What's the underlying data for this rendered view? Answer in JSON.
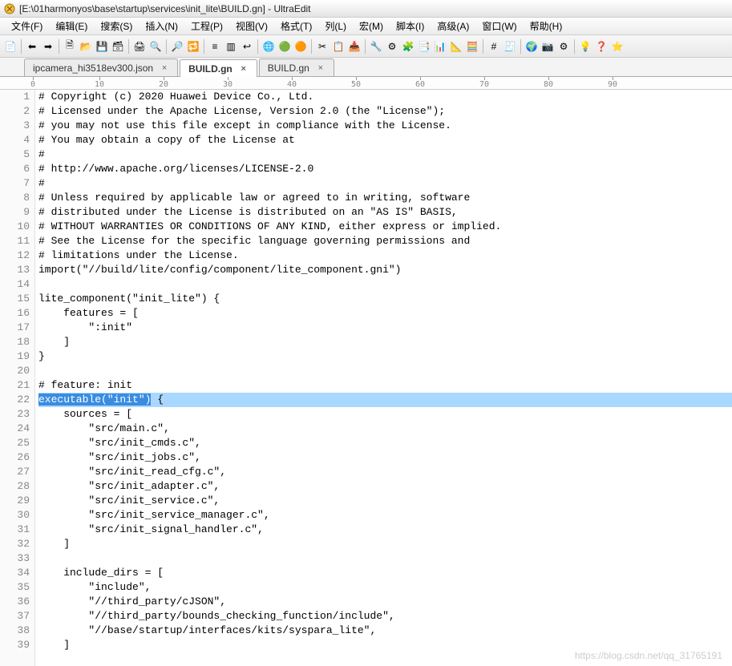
{
  "window": {
    "title": "[E:\\01harmonyos\\base\\startup\\services\\init_lite\\BUILD.gn] - UltraEdit"
  },
  "menu": {
    "items": [
      "文件(F)",
      "编辑(E)",
      "搜索(S)",
      "插入(N)",
      "工程(P)",
      "视图(V)",
      "格式(T)",
      "列(L)",
      "宏(M)",
      "脚本(I)",
      "高级(A)",
      "窗口(W)",
      "帮助(H)"
    ]
  },
  "toolbar_icons": [
    "new-file-icon",
    "sep",
    "back-icon",
    "forward-icon",
    "sep",
    "doc-icon",
    "open-icon",
    "save-icon",
    "save-all-icon",
    "sep",
    "print-icon",
    "print-preview-icon",
    "sep",
    "find-icon",
    "find-replace-icon",
    "sep",
    "list-icon",
    "col-edit-icon",
    "wrap-icon",
    "sep",
    "browser-blue-icon",
    "browser-green-icon",
    "browser-orange-icon",
    "sep",
    "cut-icon",
    "copy-icon",
    "paste-icon",
    "sep",
    "tool1-icon",
    "tool2-icon",
    "tool3-icon",
    "tool4-icon",
    "tool5-icon",
    "tool6-icon",
    "tool7-icon",
    "sep",
    "hex-icon",
    "calc-icon",
    "sep",
    "web-icon",
    "camera-icon",
    "settings-icon",
    "sep",
    "bulb-icon",
    "help-icon",
    "star-icon"
  ],
  "tabs": [
    {
      "label": "ipcamera_hi3518ev300.json",
      "active": false
    },
    {
      "label": "BUILD.gn",
      "active": true
    },
    {
      "label": "BUILD.gn",
      "active": false
    }
  ],
  "ruler": {
    "marks": [
      0,
      10,
      20,
      30,
      40,
      50,
      60,
      70,
      80,
      90
    ]
  },
  "code_lines": [
    "# Copyright (c) 2020 Huawei Device Co., Ltd.",
    "# Licensed under the Apache License, Version 2.0 (the \"License\");",
    "# you may not use this file except in compliance with the License.",
    "# You may obtain a copy of the License at",
    "#",
    "# http://www.apache.org/licenses/LICENSE-2.0",
    "#",
    "# Unless required by applicable law or agreed to in writing, software",
    "# distributed under the License is distributed on an \"AS IS\" BASIS,",
    "# WITHOUT WARRANTIES OR CONDITIONS OF ANY KIND, either express or implied.",
    "# See the License for the specific language governing permissions and",
    "# limitations under the License.",
    "import(\"//build/lite/config/component/lite_component.gni\")",
    "",
    "lite_component(\"init_lite\") {",
    "    features = [",
    "        \":init\"",
    "    ]",
    "}",
    "",
    "# feature: init",
    "executable(\"init\") {",
    "    sources = [",
    "        \"src/main.c\",",
    "        \"src/init_cmds.c\",",
    "        \"src/init_jobs.c\",",
    "        \"src/init_read_cfg.c\",",
    "        \"src/init_adapter.c\",",
    "        \"src/init_service.c\",",
    "        \"src/init_service_manager.c\",",
    "        \"src/init_signal_handler.c\",",
    "    ]",
    "",
    "    include_dirs = [",
    "        \"include\",",
    "        \"//third_party/cJSON\",",
    "        \"//third_party/bounds_checking_function/include\",",
    "        \"//base/startup/interfaces/kits/syspara_lite\",",
    "    ]"
  ],
  "highlight": {
    "line_index": 21,
    "sel_prefix": "executable(\"init\")",
    "sel_suffix": " {"
  },
  "watermark": "https://blog.csdn.net/qq_31765191",
  "glyphs": {
    "new-file-icon": "📄",
    "back-icon": "⬅",
    "forward-icon": "➡",
    "doc-icon": "🗎",
    "open-icon": "📂",
    "save-icon": "💾",
    "save-all-icon": "🗃",
    "print-icon": "🖨",
    "print-preview-icon": "🔍",
    "find-icon": "🔎",
    "find-replace-icon": "🔁",
    "list-icon": "≡",
    "col-edit-icon": "▥",
    "wrap-icon": "↩",
    "browser-blue-icon": "🌐",
    "browser-green-icon": "🟢",
    "browser-orange-icon": "🟠",
    "cut-icon": "✂",
    "copy-icon": "📋",
    "paste-icon": "📥",
    "tool1-icon": "🔧",
    "tool2-icon": "⚙",
    "tool3-icon": "🧩",
    "tool4-icon": "📑",
    "tool5-icon": "📊",
    "tool6-icon": "📐",
    "tool7-icon": "🧮",
    "hex-icon": "#",
    "calc-icon": "🧾",
    "web-icon": "🌍",
    "camera-icon": "📷",
    "settings-icon": "⚙",
    "bulb-icon": "💡",
    "help-icon": "❓",
    "star-icon": "⭐"
  }
}
